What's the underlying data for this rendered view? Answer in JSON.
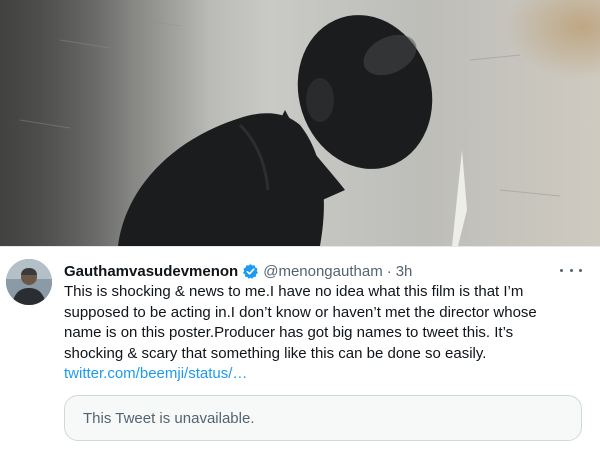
{
  "tweet": {
    "display_name": "Gauthamvasudevmenon",
    "handle": "@menongautham",
    "separator": "·",
    "time": "3h",
    "verified": true,
    "text_lines": [
      "This is shocking & news to me.I have no idea what this film is that I’m",
      "supposed to be acting in.I don’t know or haven’t met the director whose",
      "name is on this poster.Producer has got big names to tweet this. It’s",
      "shocking & scary that something like this can be done so easily."
    ],
    "link": "twitter.com/beemji/status/…",
    "quoted_tweet_text": "This Tweet is unavailable."
  },
  "icons": {
    "verified": "verified-badge-icon",
    "more": "more-options-icon"
  },
  "colors": {
    "accent": "#1d9bf0",
    "text_primary": "#0f1419",
    "text_secondary": "#536471",
    "card_border": "#cfd9de",
    "card_bg": "#f7f9f9"
  }
}
